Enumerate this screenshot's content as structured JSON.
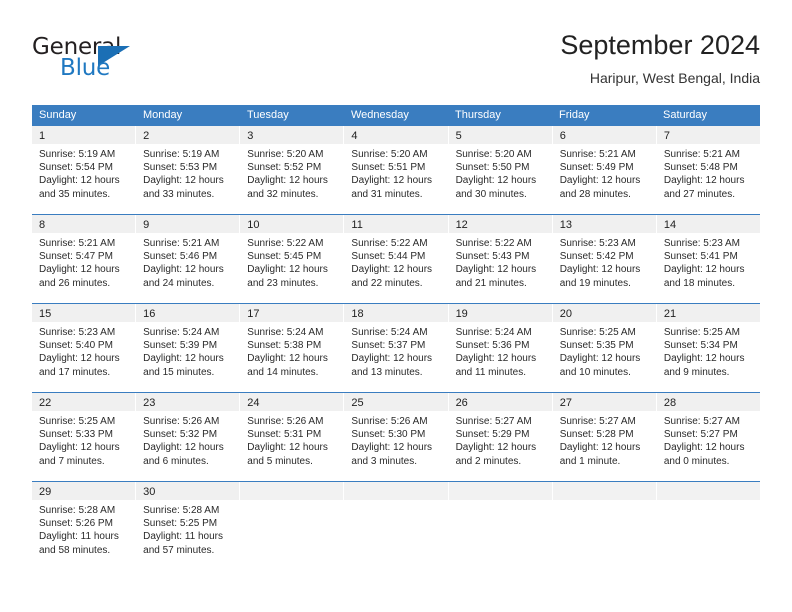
{
  "brand": {
    "word_one": "General",
    "word_two": "Blue",
    "triangle_icon": "triangle-icon",
    "colors": {
      "dark": "#231f20",
      "blue": "#1f78c1",
      "triangle": "#1b6fb5"
    }
  },
  "header": {
    "title": "September 2024",
    "subtitle": "Haripur, West Bengal, India"
  },
  "theme": {
    "header_bar": "#3a7dc0",
    "daynum_band": "#f0f0f0",
    "text": "#2a2a2a"
  },
  "weekdays": [
    "Sunday",
    "Monday",
    "Tuesday",
    "Wednesday",
    "Thursday",
    "Friday",
    "Saturday"
  ],
  "weeks": [
    [
      {
        "day": "1",
        "sunrise": "Sunrise: 5:19 AM",
        "sunset": "Sunset: 5:54 PM",
        "daylight": "Daylight: 12 hours and 35 minutes."
      },
      {
        "day": "2",
        "sunrise": "Sunrise: 5:19 AM",
        "sunset": "Sunset: 5:53 PM",
        "daylight": "Daylight: 12 hours and 33 minutes."
      },
      {
        "day": "3",
        "sunrise": "Sunrise: 5:20 AM",
        "sunset": "Sunset: 5:52 PM",
        "daylight": "Daylight: 12 hours and 32 minutes."
      },
      {
        "day": "4",
        "sunrise": "Sunrise: 5:20 AM",
        "sunset": "Sunset: 5:51 PM",
        "daylight": "Daylight: 12 hours and 31 minutes."
      },
      {
        "day": "5",
        "sunrise": "Sunrise: 5:20 AM",
        "sunset": "Sunset: 5:50 PM",
        "daylight": "Daylight: 12 hours and 30 minutes."
      },
      {
        "day": "6",
        "sunrise": "Sunrise: 5:21 AM",
        "sunset": "Sunset: 5:49 PM",
        "daylight": "Daylight: 12 hours and 28 minutes."
      },
      {
        "day": "7",
        "sunrise": "Sunrise: 5:21 AM",
        "sunset": "Sunset: 5:48 PM",
        "daylight": "Daylight: 12 hours and 27 minutes."
      }
    ],
    [
      {
        "day": "8",
        "sunrise": "Sunrise: 5:21 AM",
        "sunset": "Sunset: 5:47 PM",
        "daylight": "Daylight: 12 hours and 26 minutes."
      },
      {
        "day": "9",
        "sunrise": "Sunrise: 5:21 AM",
        "sunset": "Sunset: 5:46 PM",
        "daylight": "Daylight: 12 hours and 24 minutes."
      },
      {
        "day": "10",
        "sunrise": "Sunrise: 5:22 AM",
        "sunset": "Sunset: 5:45 PM",
        "daylight": "Daylight: 12 hours and 23 minutes."
      },
      {
        "day": "11",
        "sunrise": "Sunrise: 5:22 AM",
        "sunset": "Sunset: 5:44 PM",
        "daylight": "Daylight: 12 hours and 22 minutes."
      },
      {
        "day": "12",
        "sunrise": "Sunrise: 5:22 AM",
        "sunset": "Sunset: 5:43 PM",
        "daylight": "Daylight: 12 hours and 21 minutes."
      },
      {
        "day": "13",
        "sunrise": "Sunrise: 5:23 AM",
        "sunset": "Sunset: 5:42 PM",
        "daylight": "Daylight: 12 hours and 19 minutes."
      },
      {
        "day": "14",
        "sunrise": "Sunrise: 5:23 AM",
        "sunset": "Sunset: 5:41 PM",
        "daylight": "Daylight: 12 hours and 18 minutes."
      }
    ],
    [
      {
        "day": "15",
        "sunrise": "Sunrise: 5:23 AM",
        "sunset": "Sunset: 5:40 PM",
        "daylight": "Daylight: 12 hours and 17 minutes."
      },
      {
        "day": "16",
        "sunrise": "Sunrise: 5:24 AM",
        "sunset": "Sunset: 5:39 PM",
        "daylight": "Daylight: 12 hours and 15 minutes."
      },
      {
        "day": "17",
        "sunrise": "Sunrise: 5:24 AM",
        "sunset": "Sunset: 5:38 PM",
        "daylight": "Daylight: 12 hours and 14 minutes."
      },
      {
        "day": "18",
        "sunrise": "Sunrise: 5:24 AM",
        "sunset": "Sunset: 5:37 PM",
        "daylight": "Daylight: 12 hours and 13 minutes."
      },
      {
        "day": "19",
        "sunrise": "Sunrise: 5:24 AM",
        "sunset": "Sunset: 5:36 PM",
        "daylight": "Daylight: 12 hours and 11 minutes."
      },
      {
        "day": "20",
        "sunrise": "Sunrise: 5:25 AM",
        "sunset": "Sunset: 5:35 PM",
        "daylight": "Daylight: 12 hours and 10 minutes."
      },
      {
        "day": "21",
        "sunrise": "Sunrise: 5:25 AM",
        "sunset": "Sunset: 5:34 PM",
        "daylight": "Daylight: 12 hours and 9 minutes."
      }
    ],
    [
      {
        "day": "22",
        "sunrise": "Sunrise: 5:25 AM",
        "sunset": "Sunset: 5:33 PM",
        "daylight": "Daylight: 12 hours and 7 minutes."
      },
      {
        "day": "23",
        "sunrise": "Sunrise: 5:26 AM",
        "sunset": "Sunset: 5:32 PM",
        "daylight": "Daylight: 12 hours and 6 minutes."
      },
      {
        "day": "24",
        "sunrise": "Sunrise: 5:26 AM",
        "sunset": "Sunset: 5:31 PM",
        "daylight": "Daylight: 12 hours and 5 minutes."
      },
      {
        "day": "25",
        "sunrise": "Sunrise: 5:26 AM",
        "sunset": "Sunset: 5:30 PM",
        "daylight": "Daylight: 12 hours and 3 minutes."
      },
      {
        "day": "26",
        "sunrise": "Sunrise: 5:27 AM",
        "sunset": "Sunset: 5:29 PM",
        "daylight": "Daylight: 12 hours and 2 minutes."
      },
      {
        "day": "27",
        "sunrise": "Sunrise: 5:27 AM",
        "sunset": "Sunset: 5:28 PM",
        "daylight": "Daylight: 12 hours and 1 minute."
      },
      {
        "day": "28",
        "sunrise": "Sunrise: 5:27 AM",
        "sunset": "Sunset: 5:27 PM",
        "daylight": "Daylight: 12 hours and 0 minutes."
      }
    ],
    [
      {
        "day": "29",
        "sunrise": "Sunrise: 5:28 AM",
        "sunset": "Sunset: 5:26 PM",
        "daylight": "Daylight: 11 hours and 58 minutes."
      },
      {
        "day": "30",
        "sunrise": "Sunrise: 5:28 AM",
        "sunset": "Sunset: 5:25 PM",
        "daylight": "Daylight: 11 hours and 57 minutes."
      },
      {
        "day": "",
        "sunrise": "",
        "sunset": "",
        "daylight": ""
      },
      {
        "day": "",
        "sunrise": "",
        "sunset": "",
        "daylight": ""
      },
      {
        "day": "",
        "sunrise": "",
        "sunset": "",
        "daylight": ""
      },
      {
        "day": "",
        "sunrise": "",
        "sunset": "",
        "daylight": ""
      },
      {
        "day": "",
        "sunrise": "",
        "sunset": "",
        "daylight": ""
      }
    ]
  ]
}
